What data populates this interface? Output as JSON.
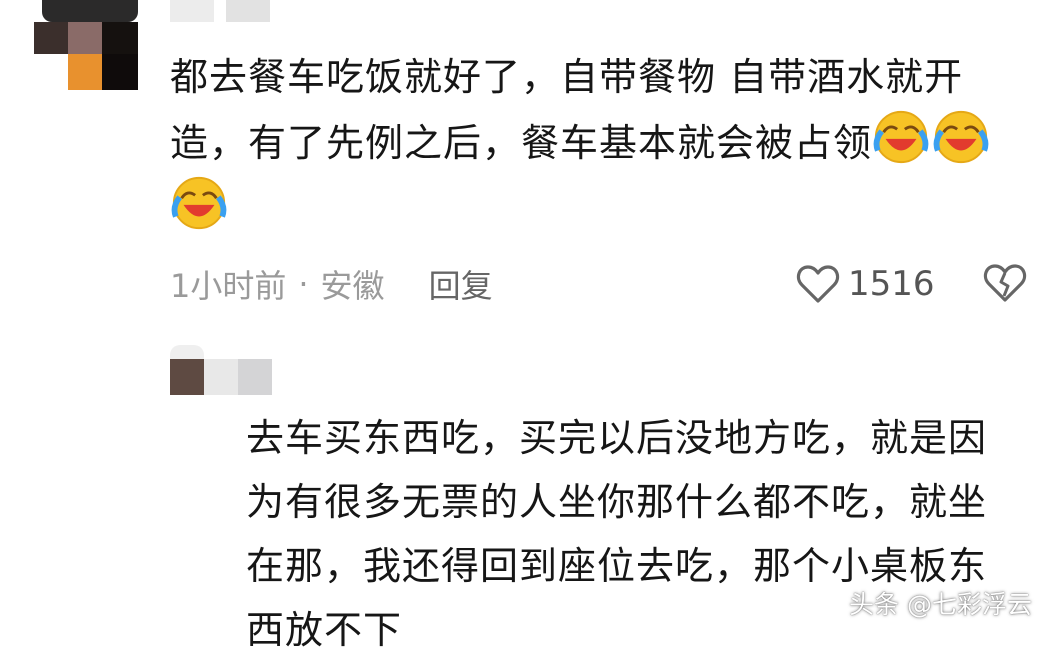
{
  "comment": {
    "text_line1": "都去餐车吃饭就好了，自带餐物 自带酒水就开",
    "text_line2": "造，有了先例之后，餐车基本就会被占领",
    "emoji_name": "laugh-cry-emoji",
    "time": "1小时前",
    "separator": "·",
    "location": "安徽",
    "reply_label": "回复",
    "like_count": "1516"
  },
  "reply": {
    "line1": "去车买东西吃，买完以后没地方吃，就是因",
    "line2": "为有很多无票的人坐你那什么都不吃，就坐",
    "line3": "在那，我还得回到座位去吃，那个小桌板东",
    "line4": "西放不下"
  },
  "watermark": "头条 @七彩浮云",
  "colors": {
    "text": "#161616",
    "meta": "#9a9a9a",
    "emoji_face": "#f7c325",
    "emoji_tear": "#3aa0f0"
  }
}
